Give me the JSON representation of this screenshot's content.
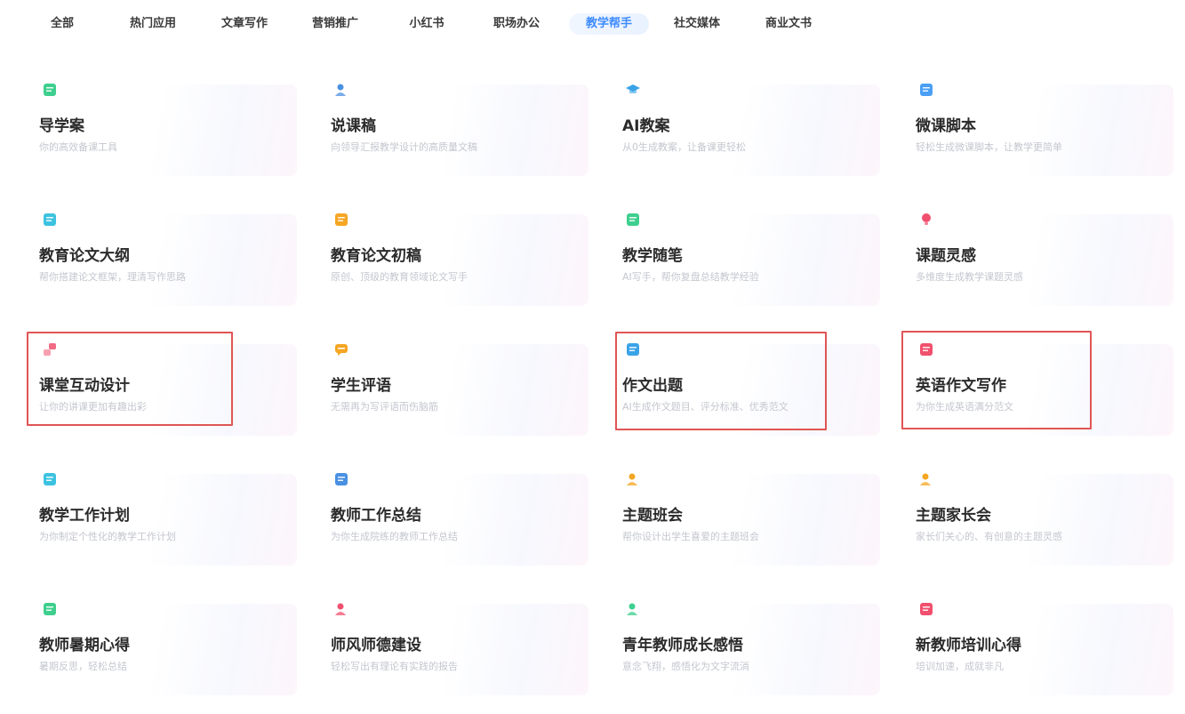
{
  "tabs": [
    {
      "label": "全部"
    },
    {
      "label": "热门应用"
    },
    {
      "label": "文章写作"
    },
    {
      "label": "营销推广"
    },
    {
      "label": "小红书"
    },
    {
      "label": "职场办公"
    },
    {
      "label": "教学帮手",
      "active": true
    },
    {
      "label": "社交媒体"
    },
    {
      "label": "商业文书"
    }
  ],
  "cards": [
    {
      "title": "导学案",
      "desc": "你的高效备课工具",
      "icon": "presentation-board-icon",
      "color": "#3ecf8e"
    },
    {
      "title": "说课稿",
      "desc": "向领导汇报教学设计的高质量文稿",
      "icon": "teacher-icon",
      "color": "#4a90e2"
    },
    {
      "title": "AI教案",
      "desc": "从0生成教案，让备课更轻松",
      "icon": "graduation-cap-icon",
      "color": "#3aa3e8"
    },
    {
      "title": "微课脚本",
      "desc": "轻松生成微课脚本，让教学更简单",
      "icon": "video-play-icon",
      "color": "#4a9ff5"
    },
    {
      "title": "教育论文大纲",
      "desc": "帮你搭建论文框架，理清写作思路",
      "icon": "document-outline-icon",
      "color": "#3dc2e0"
    },
    {
      "title": "教育论文初稿",
      "desc": "原创、顶级的教育领域论文写手",
      "icon": "pencil-note-icon",
      "color": "#f5a623"
    },
    {
      "title": "教学随笔",
      "desc": "AI写手，帮你复盘总结教学经验",
      "icon": "notebook-check-icon",
      "color": "#3ecf8e"
    },
    {
      "title": "课题灵感",
      "desc": "多维度生成教学课题灵感",
      "icon": "lightbulb-icon",
      "color": "#f0506e"
    },
    {
      "title": "课堂互动设计",
      "desc": "让你的讲课更加有趣出彩",
      "icon": "interaction-blocks-icon",
      "color": "#f0506e"
    },
    {
      "title": "学生评语",
      "desc": "无需再为写评语而伤脑筋",
      "icon": "comment-bubble-icon",
      "color": "#f5a623"
    },
    {
      "title": "作文出题",
      "desc": "AI生成作文题目、评分标准、优秀范文",
      "icon": "essay-document-icon",
      "color": "#3aa3e8"
    },
    {
      "title": "英语作文写作",
      "desc": "为你生成英语满分范文",
      "icon": "score-100-icon",
      "color": "#f0506e"
    },
    {
      "title": "教学工作计划",
      "desc": "为你制定个性化的教学工作计划",
      "icon": "checklist-icon",
      "color": "#3dc2e0"
    },
    {
      "title": "教师工作总结",
      "desc": "为你生成院练的教师工作总结",
      "icon": "calendar-check-icon",
      "color": "#4a90e2"
    },
    {
      "title": "主题班会",
      "desc": "帮你设计出学生喜爱的主题班会",
      "icon": "person-icon",
      "color": "#f5a623"
    },
    {
      "title": "主题家长会",
      "desc": "家长们关心的、有创意的主题灵感",
      "icon": "parent-icon",
      "color": "#f5a623"
    },
    {
      "title": "教师暑期心得",
      "desc": "暑期反思，轻松总结",
      "icon": "heart-note-icon",
      "color": "#3ecf8e"
    },
    {
      "title": "师风师德建设",
      "desc": "轻松写出有理论有实践的报告",
      "icon": "teacher-icon",
      "color": "#f0506e"
    },
    {
      "title": "青年教师成长感悟",
      "desc": "意念飞翔，感悟化为文字流淌",
      "icon": "teacher-icon",
      "color": "#3ecf8e"
    },
    {
      "title": "新教师培训心得",
      "desc": "培训加速，成就非凡",
      "icon": "heart-note-icon",
      "color": "#f0506e"
    }
  ]
}
